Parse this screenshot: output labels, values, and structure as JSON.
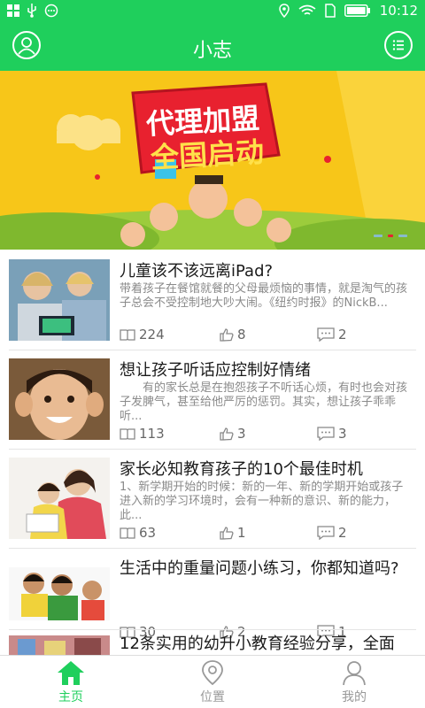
{
  "status": {
    "time": "10:12"
  },
  "appbar": {
    "title": "小志"
  },
  "banner": {
    "line1": "代理加盟",
    "line2": "全国启动"
  },
  "articles": [
    {
      "title": "儿童该不该远离iPad?",
      "desc": "带着孩子在餐馆就餐的父母最烦恼的事情，就是淘气的孩子总会不受控制地大吵大闹。《纽约时报》的NickB...",
      "views": "224",
      "likes": "8",
      "comments": "2"
    },
    {
      "title": "想让孩子听话应控制好情绪",
      "desc": "　　有的家长总是在抱怨孩子不听话心烦，有时也会对孩子发脾气，甚至给他严厉的惩罚。其实，想让孩子乖乖听...",
      "views": "113",
      "likes": "3",
      "comments": "3"
    },
    {
      "title": "家长必知教育孩子的10个最佳时机",
      "desc": "1、新学期开始的时候：新的一年、新的学期开始或孩子进入新的学习环境时，会有一种新的意识、新的能力，此...",
      "views": "63",
      "likes": "1",
      "comments": "2"
    },
    {
      "title": "生活中的重量问题小练习，你都知道吗?",
      "desc": "",
      "views": "30",
      "likes": "2",
      "comments": "1"
    },
    {
      "title": "12条实用的幼升小教育经验分享，全面",
      "desc": "",
      "views": "",
      "likes": "",
      "comments": ""
    }
  ],
  "tabs": [
    {
      "label": "主页",
      "icon": "home-icon"
    },
    {
      "label": "位置",
      "icon": "location-icon"
    },
    {
      "label": "我的",
      "icon": "person-icon"
    }
  ],
  "colors": {
    "accent": "#1fcf5c",
    "banner": "#f7c619"
  }
}
